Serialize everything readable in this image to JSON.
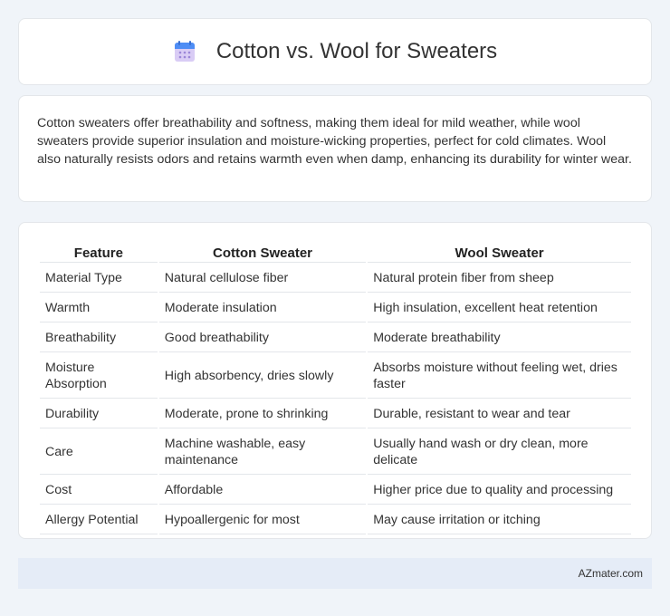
{
  "header": {
    "title": "Cotton vs. Wool for Sweaters",
    "icon": "calendar-icon"
  },
  "description": "Cotton sweaters offer breathability and softness, making them ideal for mild weather, while wool sweaters provide superior insulation and moisture-wicking properties, perfect for cold climates. Wool also naturally resists odors and retains warmth even when damp, enhancing its durability for winter wear.",
  "table": {
    "headers": [
      "Feature",
      "Cotton Sweater",
      "Wool Sweater"
    ],
    "rows": [
      [
        "Material Type",
        "Natural cellulose fiber",
        "Natural protein fiber from sheep"
      ],
      [
        "Warmth",
        "Moderate insulation",
        "High insulation, excellent heat retention"
      ],
      [
        "Breathability",
        "Good breathability",
        "Moderate breathability"
      ],
      [
        "Moisture Absorption",
        "High absorbency, dries slowly",
        "Absorbs moisture without feeling wet, dries faster"
      ],
      [
        "Durability",
        "Moderate, prone to shrinking",
        "Durable, resistant to wear and tear"
      ],
      [
        "Care",
        "Machine washable, easy maintenance",
        "Usually hand wash or dry clean, more delicate"
      ],
      [
        "Cost",
        "Affordable",
        "Higher price due to quality and processing"
      ],
      [
        "Allergy Potential",
        "Hypoallergenic for most",
        "May cause irritation or itching"
      ]
    ]
  },
  "footer": {
    "text": "AZmater.com"
  },
  "colors": {
    "background": "#f0f4f9",
    "card": "#ffffff",
    "footer": "#e5ecf7",
    "icon_top": "#4e8df5",
    "icon_body": "#c8b6f0"
  }
}
